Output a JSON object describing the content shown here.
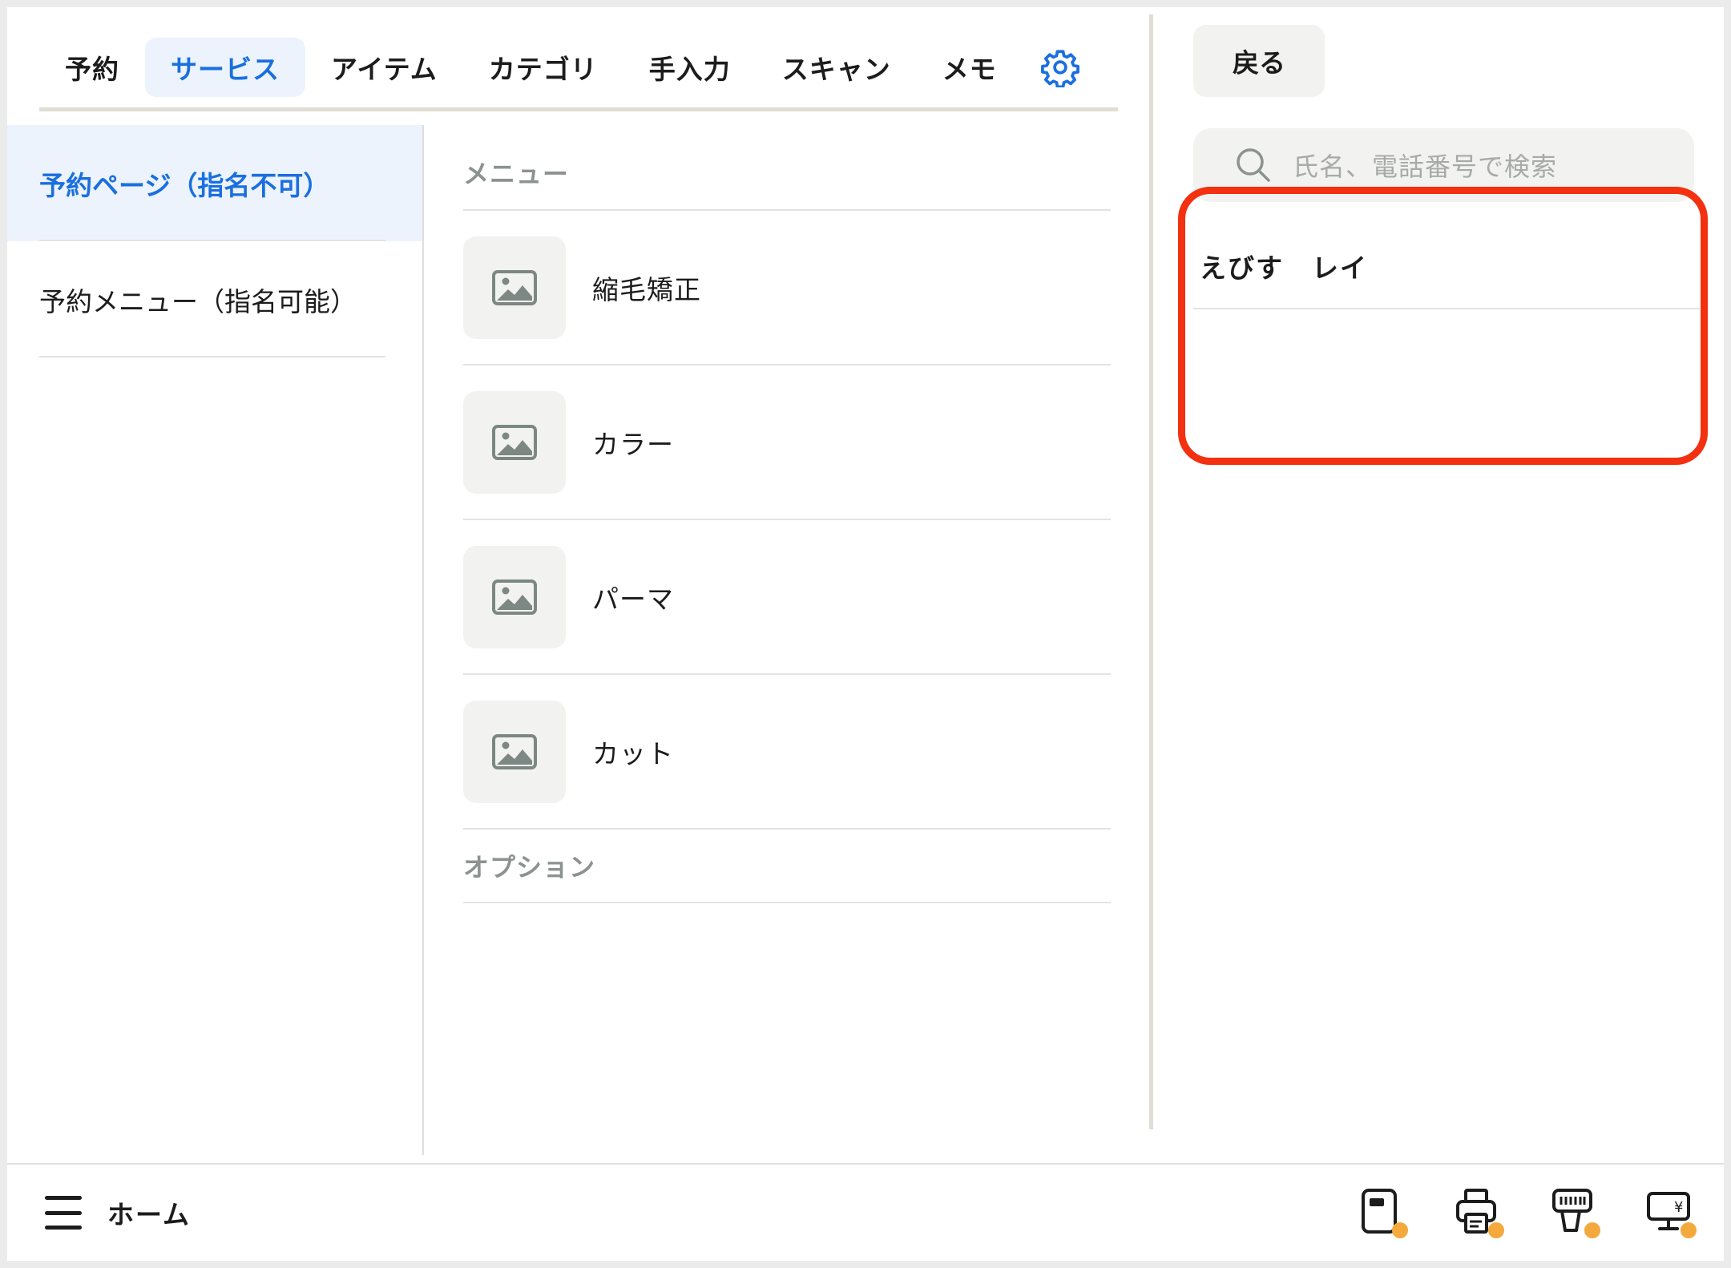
{
  "tabs": [
    {
      "label": "予約"
    },
    {
      "label": "サービス"
    },
    {
      "label": "アイテム"
    },
    {
      "label": "カテゴリ"
    },
    {
      "label": "手入力"
    },
    {
      "label": "スキャン"
    },
    {
      "label": "メモ"
    }
  ],
  "active_tab": "サービス",
  "settings_icon": "gear-icon",
  "sidebar": {
    "items": [
      {
        "label": "予約ページ（指名不可）"
      },
      {
        "label": "予約メニュー（指名可能）"
      }
    ]
  },
  "menu": {
    "section_title": "メニュー",
    "items": [
      {
        "label": "縮毛矯正",
        "icon": "image-placeholder-icon"
      },
      {
        "label": "カラー",
        "icon": "image-placeholder-icon"
      },
      {
        "label": "パーマ",
        "icon": "image-placeholder-icon"
      },
      {
        "label": "カット",
        "icon": "image-placeholder-icon"
      }
    ],
    "option_title": "オプション"
  },
  "right_panel": {
    "back_label": "戻る",
    "search_placeholder": "氏名、電話番号で検索",
    "customers": [
      {
        "name": "えびす　レイ"
      }
    ]
  },
  "bottom_bar": {
    "home_label": "ホーム",
    "devices": [
      "card-reader-icon",
      "receipt-printer-icon",
      "barcode-scanner-icon",
      "cash-register-icon"
    ]
  },
  "colors": {
    "accent": "#1a6fe0",
    "active_bg": "#ecf3fd",
    "highlight": "#f3300f",
    "status_dot": "#f3a93b"
  }
}
